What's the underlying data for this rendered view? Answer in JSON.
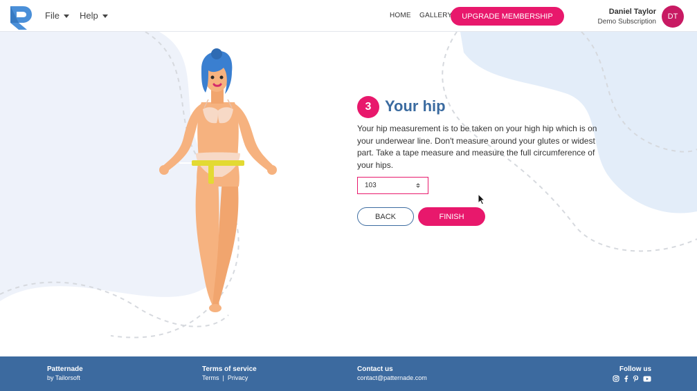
{
  "header": {
    "menus": [
      "File",
      "Help"
    ],
    "nav": [
      "HOME",
      "GALLERY"
    ],
    "upgrade_label": "UPGRADE MEMBERSHIP",
    "user": {
      "name": "Daniel Taylor",
      "subscription": "Demo Subscription",
      "initials": "DT"
    }
  },
  "step": {
    "number": "3",
    "title": "Your hip",
    "description": "Your hip measurement is to be taken on your high hip which is on your underwear line. Don't measure around your glutes or widest part. Take a tape measure and measure the full circumference of your hips.",
    "input_value": "103",
    "back_label": "BACK",
    "finish_label": "FINISH"
  },
  "footer": {
    "brand": {
      "title": "Patternade",
      "subtitle": "by Tailorsoft"
    },
    "terms": {
      "title": "Terms of service",
      "links": [
        "Terms",
        "Privacy"
      ]
    },
    "contact": {
      "title": "Contact us",
      "email": "contact@patternade.com"
    },
    "follow": {
      "title": "Follow us",
      "icons": [
        "instagram-icon",
        "facebook-icon",
        "pinterest-icon",
        "youtube-icon"
      ]
    }
  },
  "colors": {
    "accent": "#e8186c",
    "primary": "#3c6a9f",
    "title": "#3b6ba0",
    "bg_blob": "#eef2fa"
  }
}
